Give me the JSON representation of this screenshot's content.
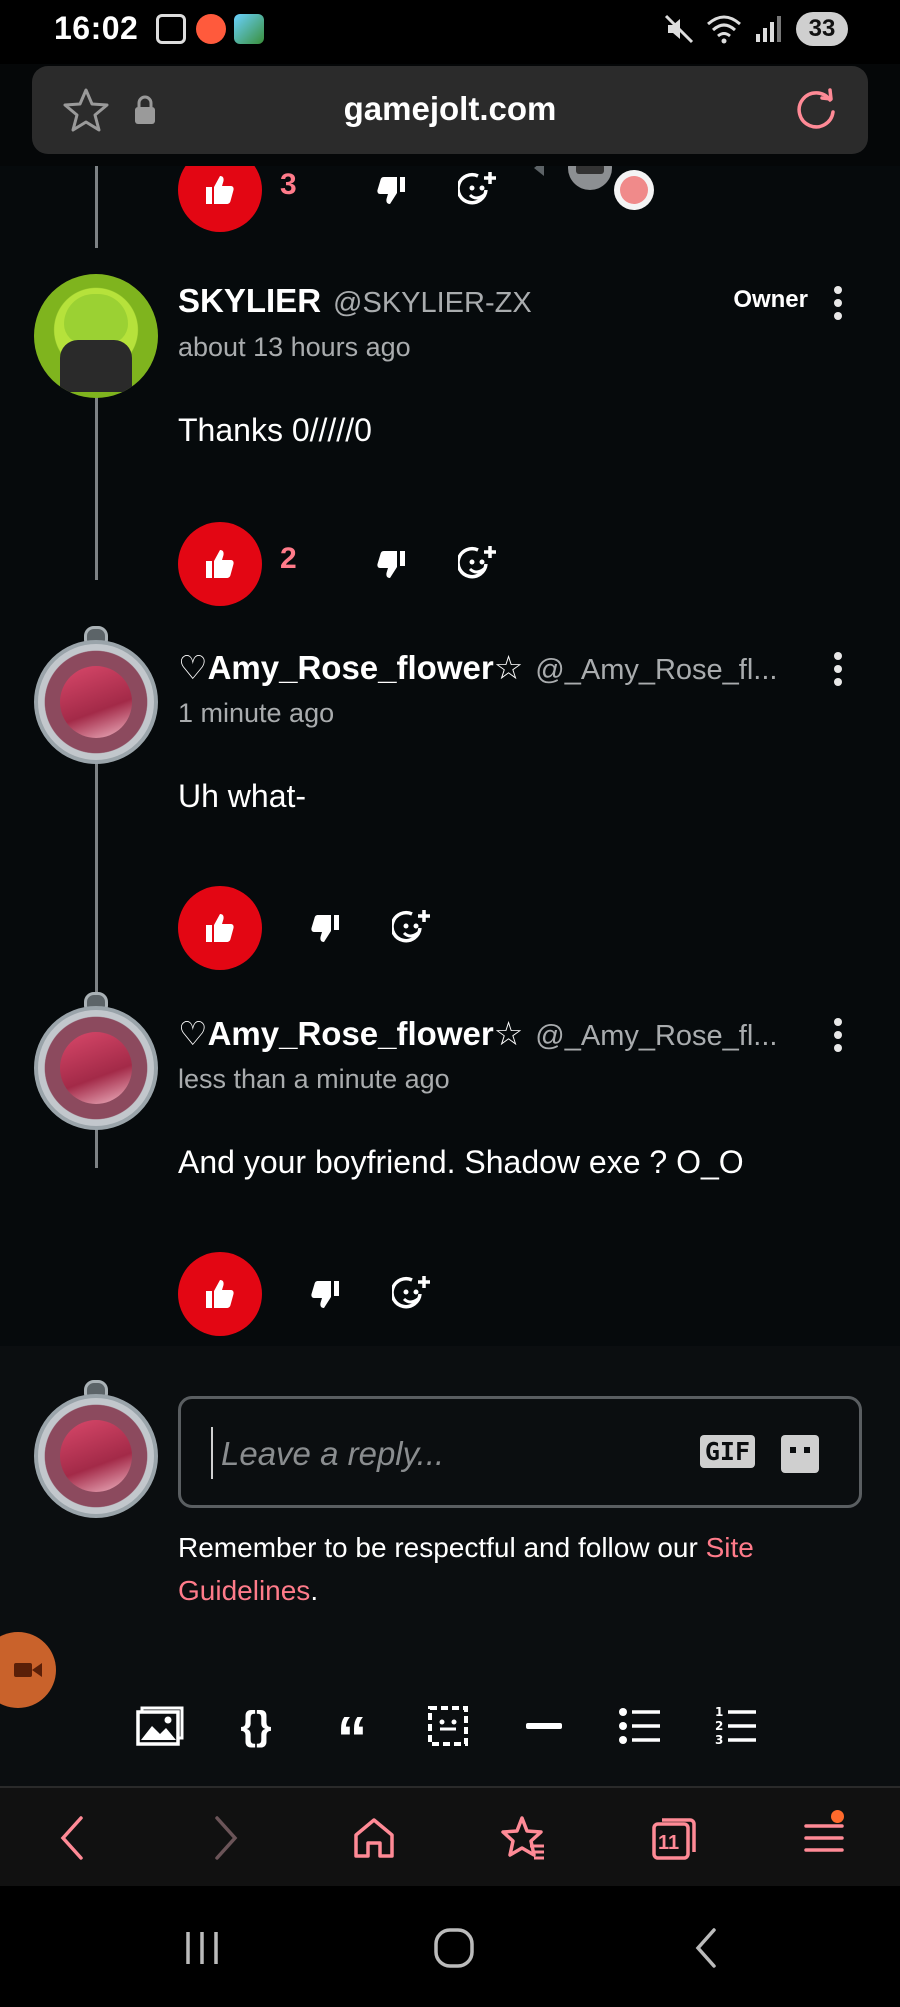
{
  "status_bar": {
    "time": "16:02",
    "battery": "33"
  },
  "browser": {
    "url": "gamejolt.com"
  },
  "partial_comment": {
    "like_count": "3"
  },
  "comments": [
    {
      "name": "SKYLIER",
      "handle": "@SKYLIER-ZX",
      "badge": "Owner",
      "time": "about 13 hours ago",
      "body": "Thanks 0/////0",
      "like_count": "2"
    },
    {
      "name": "♡Amy_Rose_flower☆",
      "handle": "@_Amy_Rose_fl...",
      "time": "1 minute ago",
      "body": "Uh what-",
      "like_count": ""
    },
    {
      "name": "♡Amy_Rose_flower☆",
      "handle": "@_Amy_Rose_fl...",
      "time": "less than a minute ago",
      "body": "And  your boyfriend.  Shadow exe ? O_O",
      "like_count": ""
    }
  ],
  "reply": {
    "placeholder": "Leave a reply...",
    "gif_label": "GIF",
    "guidelines_text": "Remember to be respectful and follow our ",
    "guidelines_link": "Site Guidelines",
    "guidelines_end": "."
  },
  "toolbar": {
    "code_label": "{}",
    "quote_label": "“"
  },
  "browser_nav": {
    "tabs_count": "11"
  },
  "colors": {
    "like": "#e30613",
    "link": "#ff7b8a",
    "accent_orange": "#ff6a2c"
  }
}
